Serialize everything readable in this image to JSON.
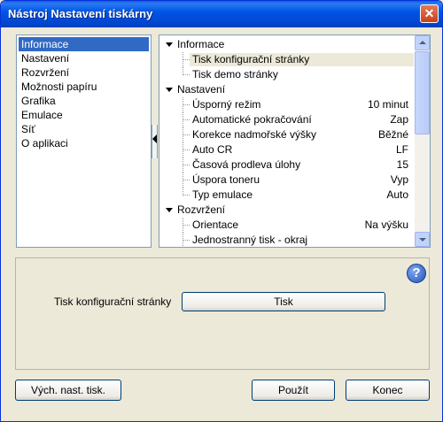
{
  "window": {
    "title": "Nástroj Nastavení tiskárny",
    "close_glyph": "✕"
  },
  "left_list": {
    "items": [
      {
        "label": "Informace",
        "selected": true
      },
      {
        "label": "Nastavení"
      },
      {
        "label": "Rozvržení"
      },
      {
        "label": "Možnosti papíru"
      },
      {
        "label": "Grafika"
      },
      {
        "label": "Emulace"
      },
      {
        "label": "Síť"
      },
      {
        "label": "O aplikaci"
      }
    ]
  },
  "tree": {
    "cat_informace": "Informace",
    "tisk_konfig": "Tisk konfigurační stránky",
    "tisk_demo": "Tisk demo stránky",
    "cat_nastaveni": "Nastavení",
    "settings": [
      {
        "label": "Úsporný režim",
        "value": "10 minut"
      },
      {
        "label": "Automatické pokračování",
        "value": "Zap"
      },
      {
        "label": "Korekce nadmořské výšky",
        "value": "Běžné"
      },
      {
        "label": "Auto CR",
        "value": "LF"
      },
      {
        "label": "Časová prodleva úlohy",
        "value": "15"
      },
      {
        "label": "Úspora toneru",
        "value": "Vyp"
      },
      {
        "label": "Typ emulace",
        "value": "Auto"
      }
    ],
    "cat_rozvrzeni": "Rozvržení",
    "layout": [
      {
        "label": "Orientace",
        "value": "Na výšku"
      },
      {
        "label": "Jednostranný tisk - okraj",
        "value": ""
      }
    ]
  },
  "panel": {
    "help_glyph": "?",
    "action_label": "Tisk konfigurační stránky",
    "action_button": "Tisk"
  },
  "footer": {
    "defaults_button": "Vých. nast. tisk.",
    "apply_button": "Použít",
    "close_button": "Konec"
  }
}
